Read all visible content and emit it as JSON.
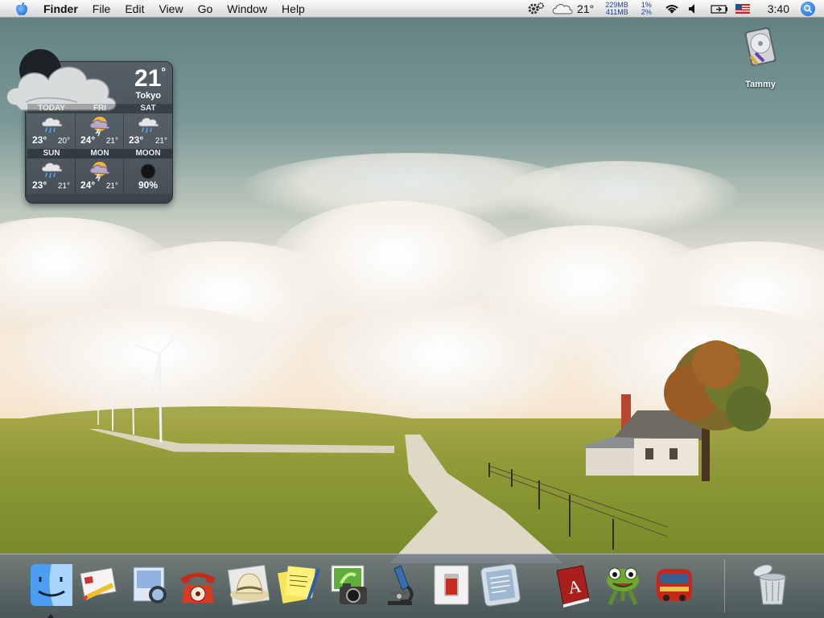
{
  "menubar": {
    "app_name": "Finder",
    "items": [
      "File",
      "Edit",
      "View",
      "Go",
      "Window",
      "Help"
    ],
    "status": {
      "weather_temp": "21°",
      "mem_used": "229MB",
      "mem_free": "411MB",
      "cpu_1": "1%",
      "cpu_2": "2%",
      "clock": "3:40"
    }
  },
  "weather_widget": {
    "temp": "21",
    "degree": "°",
    "city": "Tokyo",
    "days": [
      {
        "label": "TODAY",
        "hi": "23°",
        "lo": "20°",
        "icon": "rain-cloud-icon"
      },
      {
        "label": "FRI",
        "hi": "24°",
        "lo": "21°",
        "icon": "thunderstorm-icon"
      },
      {
        "label": "SAT",
        "hi": "23°",
        "lo": "21°",
        "icon": "rain-cloud-icon"
      },
      {
        "label": "SUN",
        "hi": "23°",
        "lo": "21°",
        "icon": "rain-cloud-icon"
      },
      {
        "label": "MON",
        "hi": "24°",
        "lo": "21°",
        "icon": "thunderstorm-icon"
      }
    ],
    "moon": {
      "label": "MOON",
      "value": "90%"
    }
  },
  "desktop_icons": [
    {
      "label": "Tammy",
      "icon": "hard-drive-icon"
    }
  ],
  "dock": {
    "apps": [
      "finder-icon",
      "mail-icon",
      "preview-icon",
      "phone-icon",
      "safari-hat-icon",
      "stickies-icon",
      "iphoto-icon",
      "camera-icon",
      "microscope-icon",
      "switch-icon",
      "tablet-icon",
      "dictionary-icon",
      "frog-icon",
      "train-icon"
    ],
    "trash": "trash-icon"
  },
  "colors": {
    "menubar": "#e6e6e6",
    "widget_bg": "#4a545c",
    "spotlight": "#1763d6"
  }
}
